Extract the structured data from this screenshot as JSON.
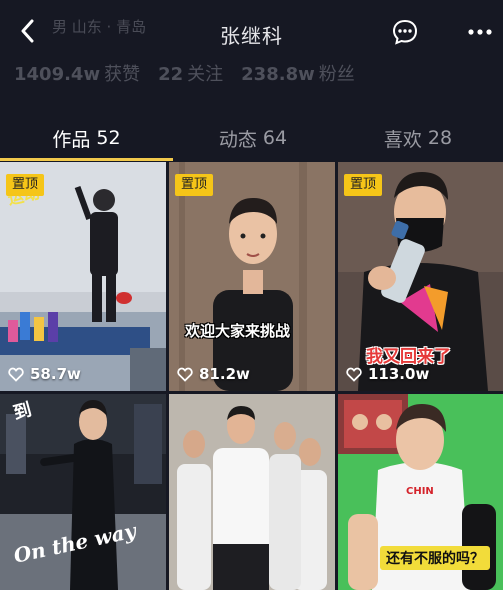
{
  "header": {
    "location": "男  山东 · 青岛",
    "title": "张继科"
  },
  "stats": [
    {
      "value": "1409.4w",
      "label": "获赞"
    },
    {
      "value": "22",
      "label": "关注"
    },
    {
      "value": "238.8w",
      "label": "粉丝"
    }
  ],
  "tabs": [
    {
      "label": "作品",
      "count": "52"
    },
    {
      "label": "动态",
      "count": "64"
    },
    {
      "label": "喜欢",
      "count": "28"
    }
  ],
  "videos": [
    {
      "pinned": "置顶",
      "likes": "58.7w",
      "caption": ""
    },
    {
      "pinned": "置顶",
      "likes": "81.2w",
      "caption": "欢迎大家来挑战"
    },
    {
      "pinned": "置顶",
      "likes": "113.0w",
      "caption": "我又回来了"
    },
    {
      "pinned": "",
      "likes": "",
      "caption": "On the way"
    },
    {
      "pinned": "",
      "likes": "",
      "caption": ""
    },
    {
      "pinned": "",
      "likes": "",
      "caption": "还有不服的吗？"
    }
  ],
  "colors": {
    "background": "#161823",
    "accent": "#f2c94c",
    "pin": "#f5c518"
  }
}
